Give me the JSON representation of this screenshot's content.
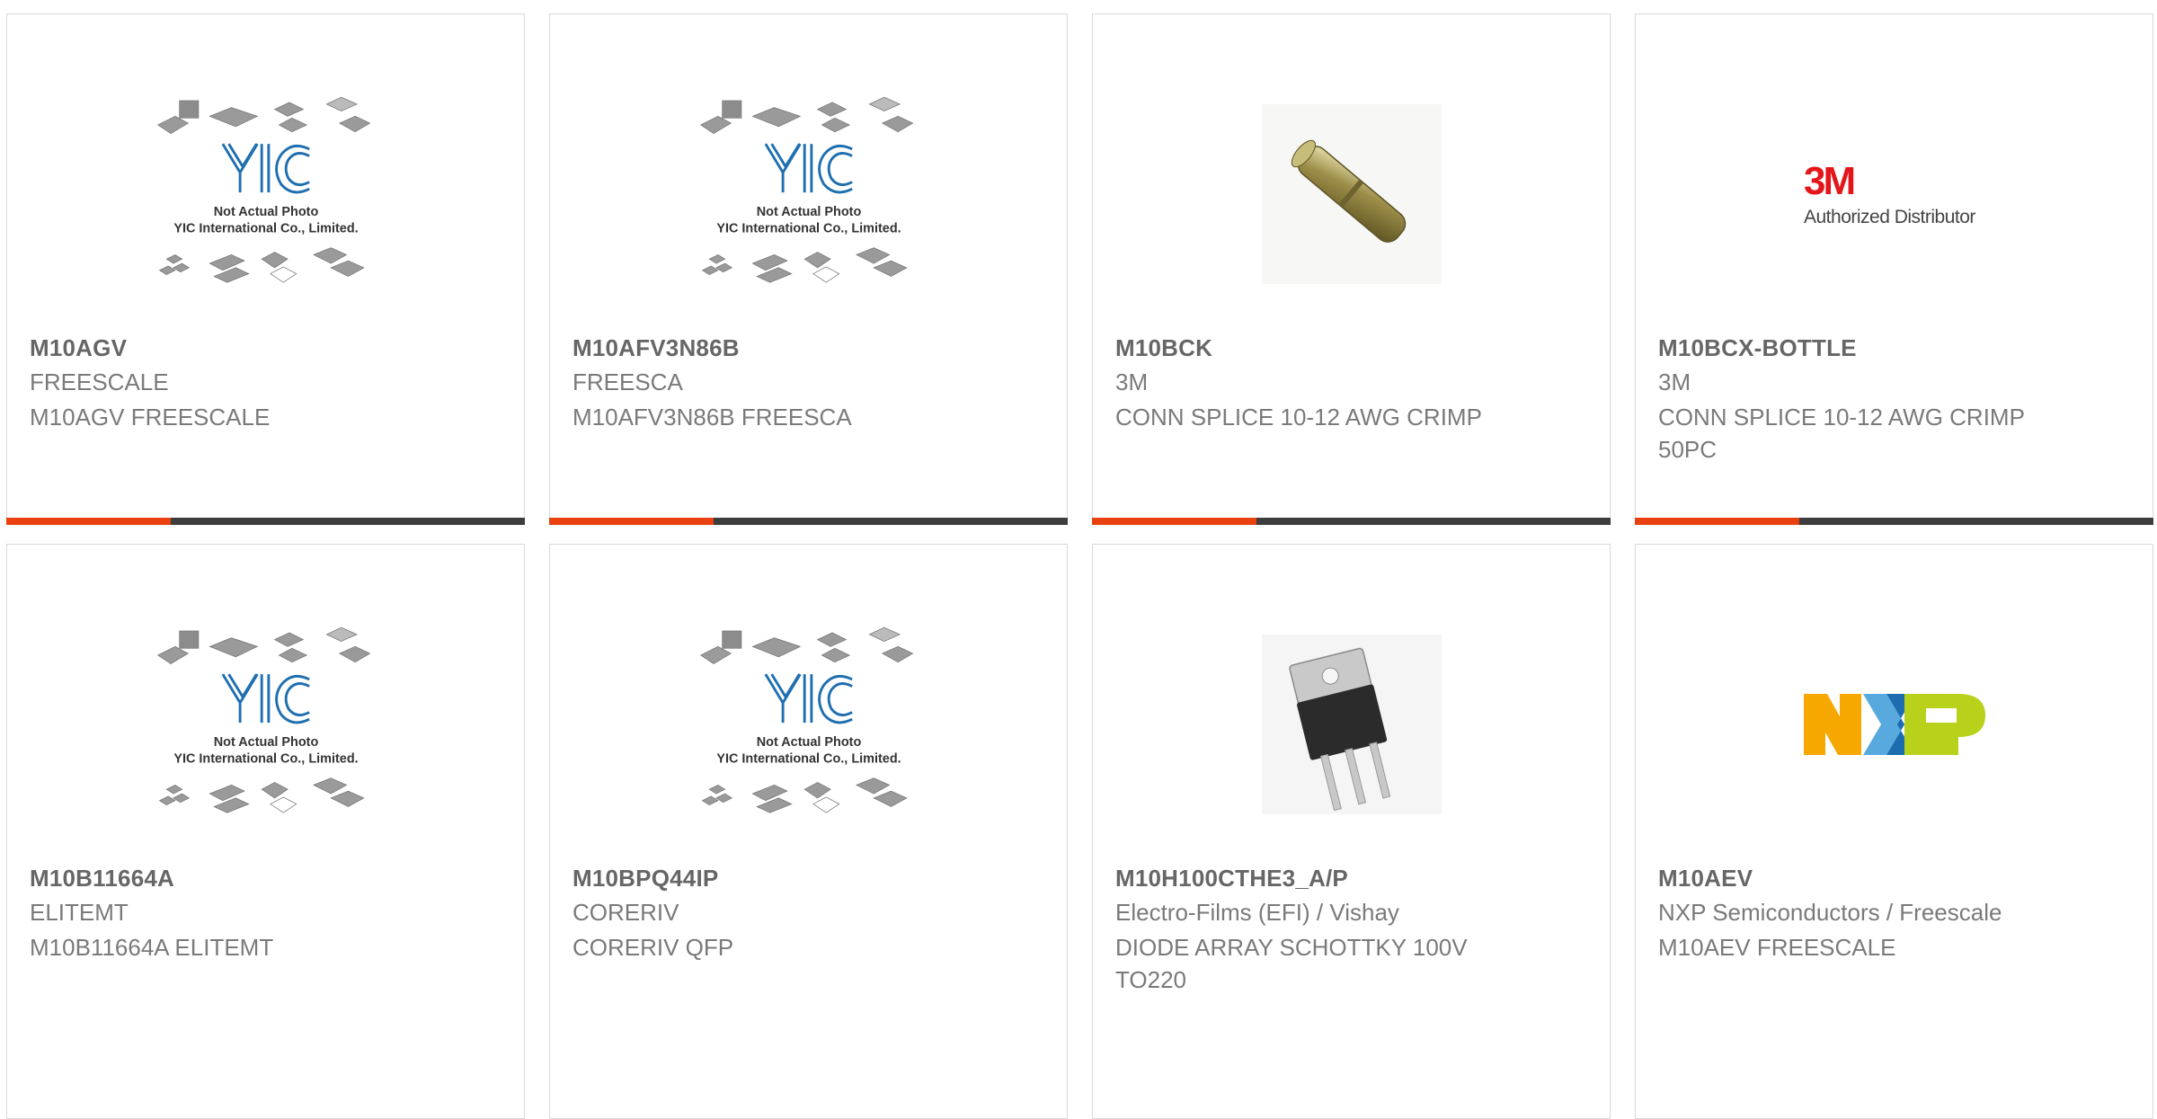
{
  "products": [
    {
      "part": "M10AGV",
      "maker": "FREESCALE",
      "desc": "M10AGV FREESCALE",
      "image": "yic-placeholder",
      "image_caption_1": "Not Actual Photo",
      "image_caption_2": "YIC International Co., Limited."
    },
    {
      "part": "M10AFV3N86B",
      "maker": "FREESCA",
      "desc": "M10AFV3N86B FREESCA",
      "image": "yic-placeholder",
      "image_caption_1": "Not Actual Photo",
      "image_caption_2": "YIC International Co., Limited."
    },
    {
      "part": "M10BCK",
      "maker": "3M",
      "desc": "CONN SPLICE 10-12 AWG CRIMP",
      "image": "splice-connector-photo"
    },
    {
      "part": "M10BCX-BOTTLE",
      "maker": "3M",
      "desc": "CONN SPLICE 10-12 AWG CRIMP 50PC",
      "image": "3m-logo",
      "logo_text": "3M",
      "logo_subtext": "Authorized Distributor"
    },
    {
      "part": "M10B11664A",
      "maker": "ELITEMT",
      "desc": "M10B11664A ELITEMT",
      "image": "yic-placeholder",
      "image_caption_1": "Not Actual Photo",
      "image_caption_2": "YIC International Co., Limited."
    },
    {
      "part": "M10BPQ44IP",
      "maker": "CORERIV",
      "desc": "CORERIV QFP",
      "image": "yic-placeholder",
      "image_caption_1": "Not Actual Photo",
      "image_caption_2": "YIC International Co., Limited."
    },
    {
      "part": "M10H100CTHE3_A/P",
      "maker": "Electro-Films (EFI) / Vishay",
      "desc": "DIODE ARRAY SCHOTTKY 100V TO220",
      "image": "to220-photo"
    },
    {
      "part": "M10AEV",
      "maker": "NXP Semiconductors / Freescale",
      "desc": "M10AEV FREESCALE",
      "image": "nxp-logo"
    }
  ],
  "colors": {
    "accent": "#e8400f",
    "bar": "#3d3d3d",
    "text": "#7a7a7a",
    "yic_blue": "#1f6fb0"
  }
}
